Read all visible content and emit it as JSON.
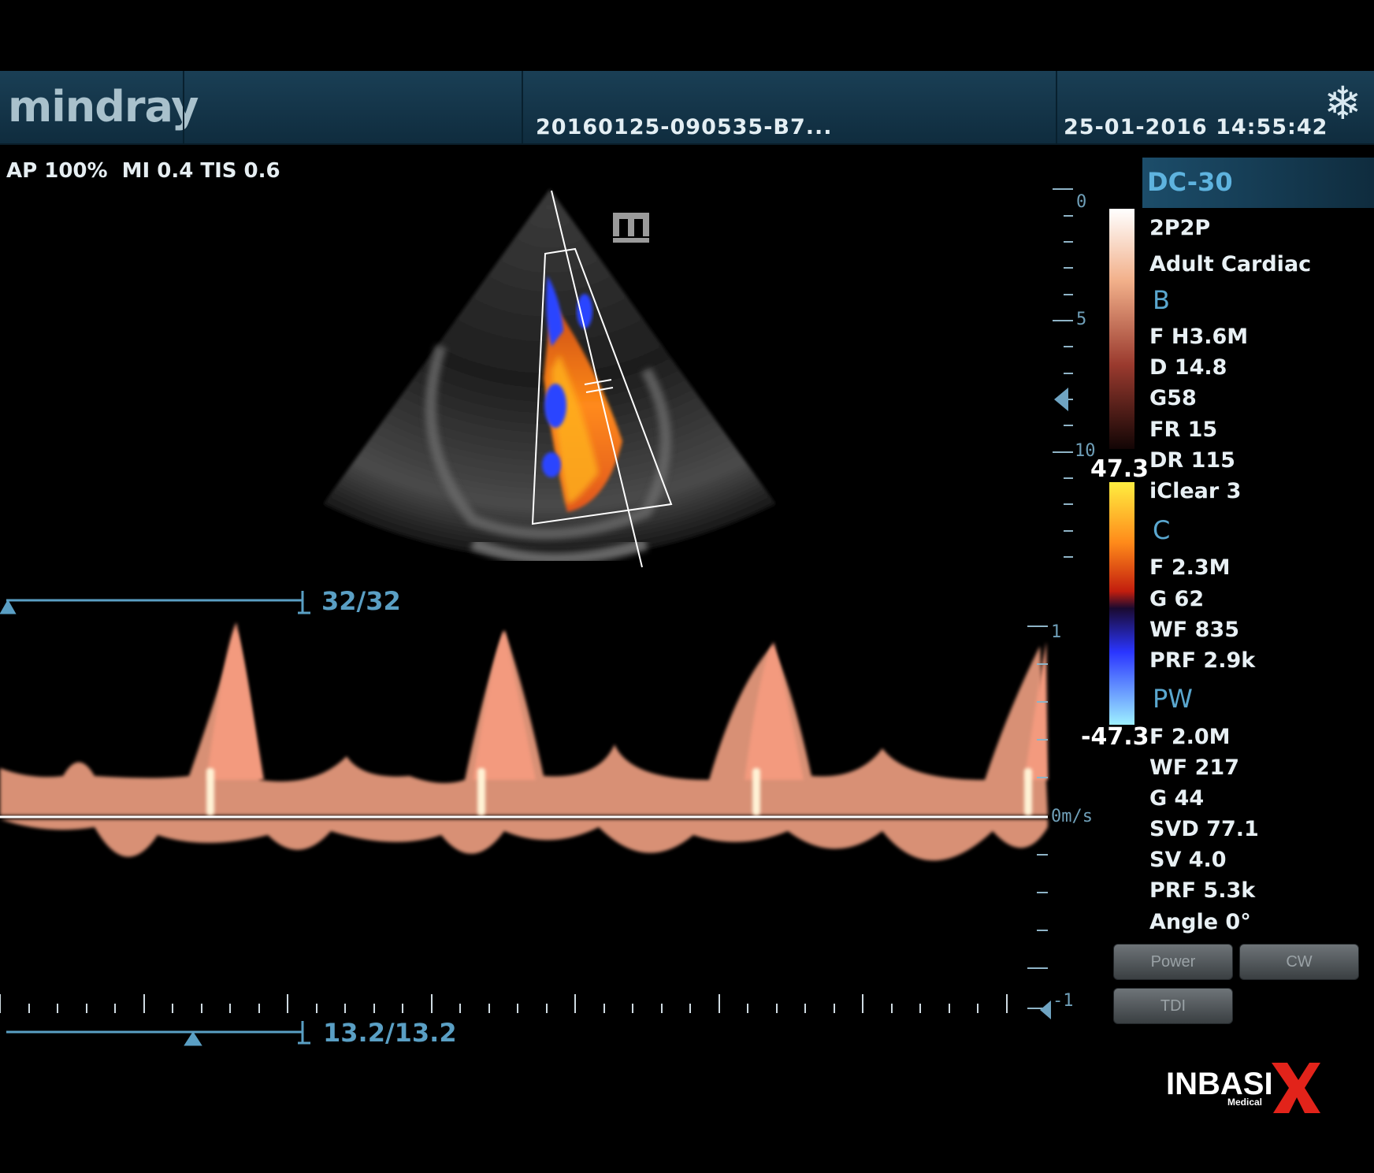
{
  "header": {
    "brand": "mindray",
    "exam_id": "20160125-090535-B7...",
    "datetime": "25-01-2016 14:55:42",
    "freeze_icon": "snowflake-icon"
  },
  "readout": {
    "power": "AP 100%  MI 0.4 TIS 0.6"
  },
  "probe": {
    "name": "DC-30",
    "transducer": "2P2P",
    "exam_type": "Adult Cardiac"
  },
  "modes": {
    "b": {
      "label": "B",
      "params": [
        "F H3.6M",
        "D 14.8",
        "G58",
        "FR 15",
        "DR 115",
        "iClear 3"
      ]
    },
    "c": {
      "label": "C",
      "params": [
        "F 2.3M",
        "G 62",
        "WF 835",
        "PRF 2.9k"
      ]
    },
    "pw": {
      "label": "PW",
      "params": [
        "F 2.0M",
        "WF 217",
        "G 44",
        "SVD 77.1",
        "SV 4.0",
        "PRF 5.3k",
        "Angle 0°"
      ]
    }
  },
  "color_scale": {
    "max": "47.3",
    "min": "-47.3"
  },
  "depth_scale": {
    "ticks": [
      "0",
      "5",
      "10"
    ]
  },
  "doppler_scale": {
    "top": "1",
    "baseline": "0m/s",
    "bottom": "-1"
  },
  "cine": {
    "image_counter": "32/32",
    "time_counter": "13.2/13.2"
  },
  "buttons": {
    "power": "Power",
    "cw": "CW",
    "tdi": "TDI"
  },
  "watermark": {
    "text": "INBASIX",
    "subtext": "Medical"
  },
  "colors": {
    "header_bg": "#123347",
    "accent": "#5aa7cf",
    "doppler": "#f3a184",
    "color_pos": "#ff7a1a",
    "color_neg": "#2a4bff"
  }
}
